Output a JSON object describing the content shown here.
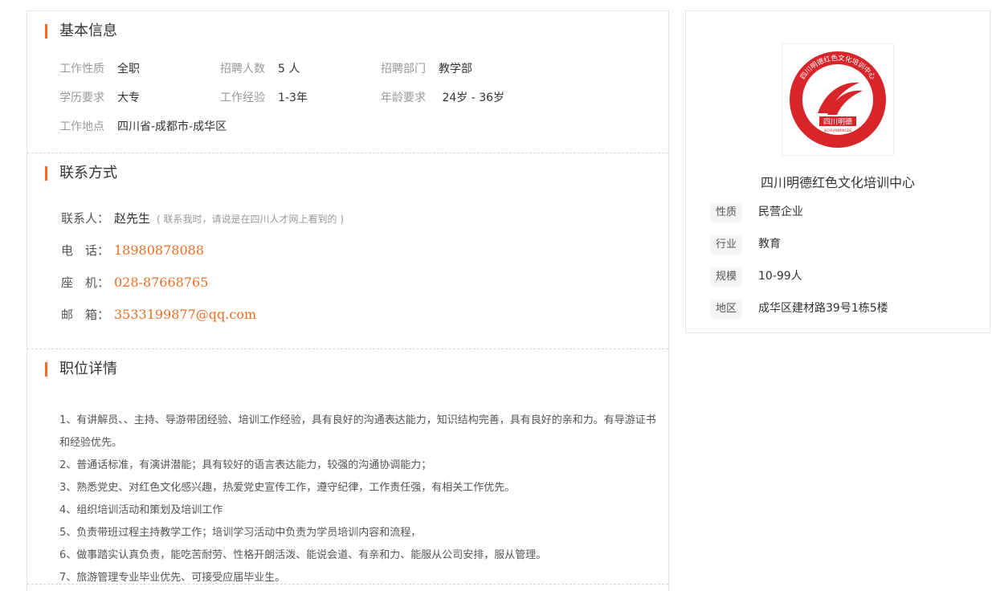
{
  "basic": {
    "title": "基本信息",
    "rows": [
      [
        {
          "label": "工作性质",
          "value": "全职"
        },
        {
          "label": "招聘人数",
          "value": "5 人"
        },
        {
          "label": "招聘部门",
          "value": "教学部"
        }
      ],
      [
        {
          "label": "学历要求",
          "value": "大专"
        },
        {
          "label": "工作经验",
          "value": "1-3年"
        },
        {
          "label": "年龄要求",
          "value": " 24岁 - 36岁"
        }
      ],
      [
        {
          "label": "工作地点",
          "value": "四川省-成都市-成华区"
        }
      ]
    ]
  },
  "contact": {
    "title": "联系方式",
    "person_label": "联系人：",
    "person": "赵先生",
    "hint": "( 联系我时，请说是在四川人才网上看到的 )",
    "phone_label": "电　话：",
    "phone": "18980878088",
    "landline_label": "座　机：",
    "landline": "028-87668765",
    "email_label": "邮　箱：",
    "email": "3533199877@qq.com"
  },
  "detail": {
    "title": "职位详情",
    "lines": [
      "1、有讲解员、、主持、导游带团经验、培训工作经验，具有良好的沟通表达能力，知识结构完善，具有良好的亲和力。有导游证书和经验优先。",
      "2、普通话标准，有演讲潜能；具有较好的语言表达能力，较强的沟通协调能力；",
      "3、熟悉党史、对红色文化感兴趣，热爱党史宣传工作，遵守纪律，工作责任强，有相关工作优先。",
      "4、组织培训活动和策划及培训工作",
      "5、负责带班过程主持教学工作；培训学习活动中负责为学员培训内容和流程，",
      "6、做事踏实认真负责，能吃苦耐劳、性格开朗活泼、能说会道、有亲和力、能服从公司安排，服从管理。",
      "7、旅游管理专业毕业优先、可接受应届毕业生。"
    ]
  },
  "company": {
    "logo_text_top": "四川明德红色文化培训中心",
    "logo_text_center": "四川明德",
    "logo_text_small": "SICHUANMINGDE",
    "name": "四川明德红色文化培训中心",
    "rows": [
      {
        "tag": "性质",
        "value": "民营企业"
      },
      {
        "tag": "行业",
        "value": "教育"
      },
      {
        "tag": "规模",
        "value": "10-99人"
      },
      {
        "tag": "地区",
        "value": "成华区建材路39号1栋5楼"
      }
    ],
    "brand_color": "#d9252a"
  }
}
